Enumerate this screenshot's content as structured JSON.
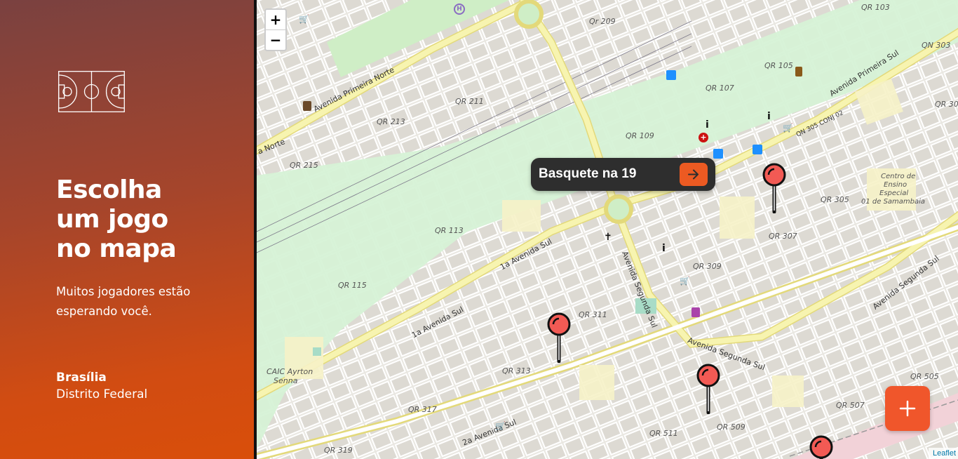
{
  "sidebar": {
    "logo_icon": "basketball-court-icon",
    "headline": [
      "Escolha",
      "um jogo",
      "no mapa"
    ],
    "subtitle_lines": [
      "Muitos jogadores estão",
      "esperando você."
    ],
    "city": "Brasília",
    "state": "Distrito Federal"
  },
  "map": {
    "zoom_in": "+",
    "zoom_out": "−",
    "popup": {
      "title": "Basquete na 19",
      "button_icon": "arrow-right-icon"
    },
    "fab_icon": "plus-icon",
    "attribution": "Leaflet",
    "labels": {
      "qr209": "Qr 209",
      "qr211": "QR 211",
      "qr213": "QR 213",
      "qr215": "QR 215",
      "qr113": "QR 113",
      "qr115": "QR 115",
      "qr105": "QR 105",
      "qr107": "QR 107",
      "qr109": "QR 109",
      "qr103": "QR 103",
      "qr305": "QR 305",
      "qr307": "QR 307",
      "qr309": "QR 309",
      "qr311": "QR 311",
      "qr313": "QR 313",
      "qr317": "QR 317",
      "qr319": "QR 319",
      "qr511": "QR 511",
      "qr509": "QR 509",
      "qr505": "QR 505",
      "qr507": "QR 507",
      "qn303": "QN 303",
      "qr30": "QR 30",
      "caic1": "CAIC Ayrton",
      "caic2": "Senna",
      "centro1": "Centro de",
      "centro2": "Ensino",
      "centro3": "Especial",
      "centro4": "01 de Samambaia"
    },
    "roads": {
      "ap_norte": "Avenida Primeira Norte",
      "norte": "a Norte",
      "ap_sul": "Avenida Primeira Sul",
      "av1_sul_a": "1a Avenida Sul",
      "av1_sul_b": "1a Avenida Sul",
      "av2_sul": "2a Avenida Sul",
      "as_sul_a": "Avenida Segunda Sul",
      "as_sul_b": "Avenida Segunda Sul",
      "as_sul_c": "Avenida Segunda Sul",
      "qn305": "QN 305 CONJ 02"
    }
  },
  "colors": {
    "accent": "#f0562b",
    "popup_bg": "#2e2e2e",
    "pin": "#f25a54",
    "park": "#c9f0cf",
    "road": "#f7f4b0"
  }
}
